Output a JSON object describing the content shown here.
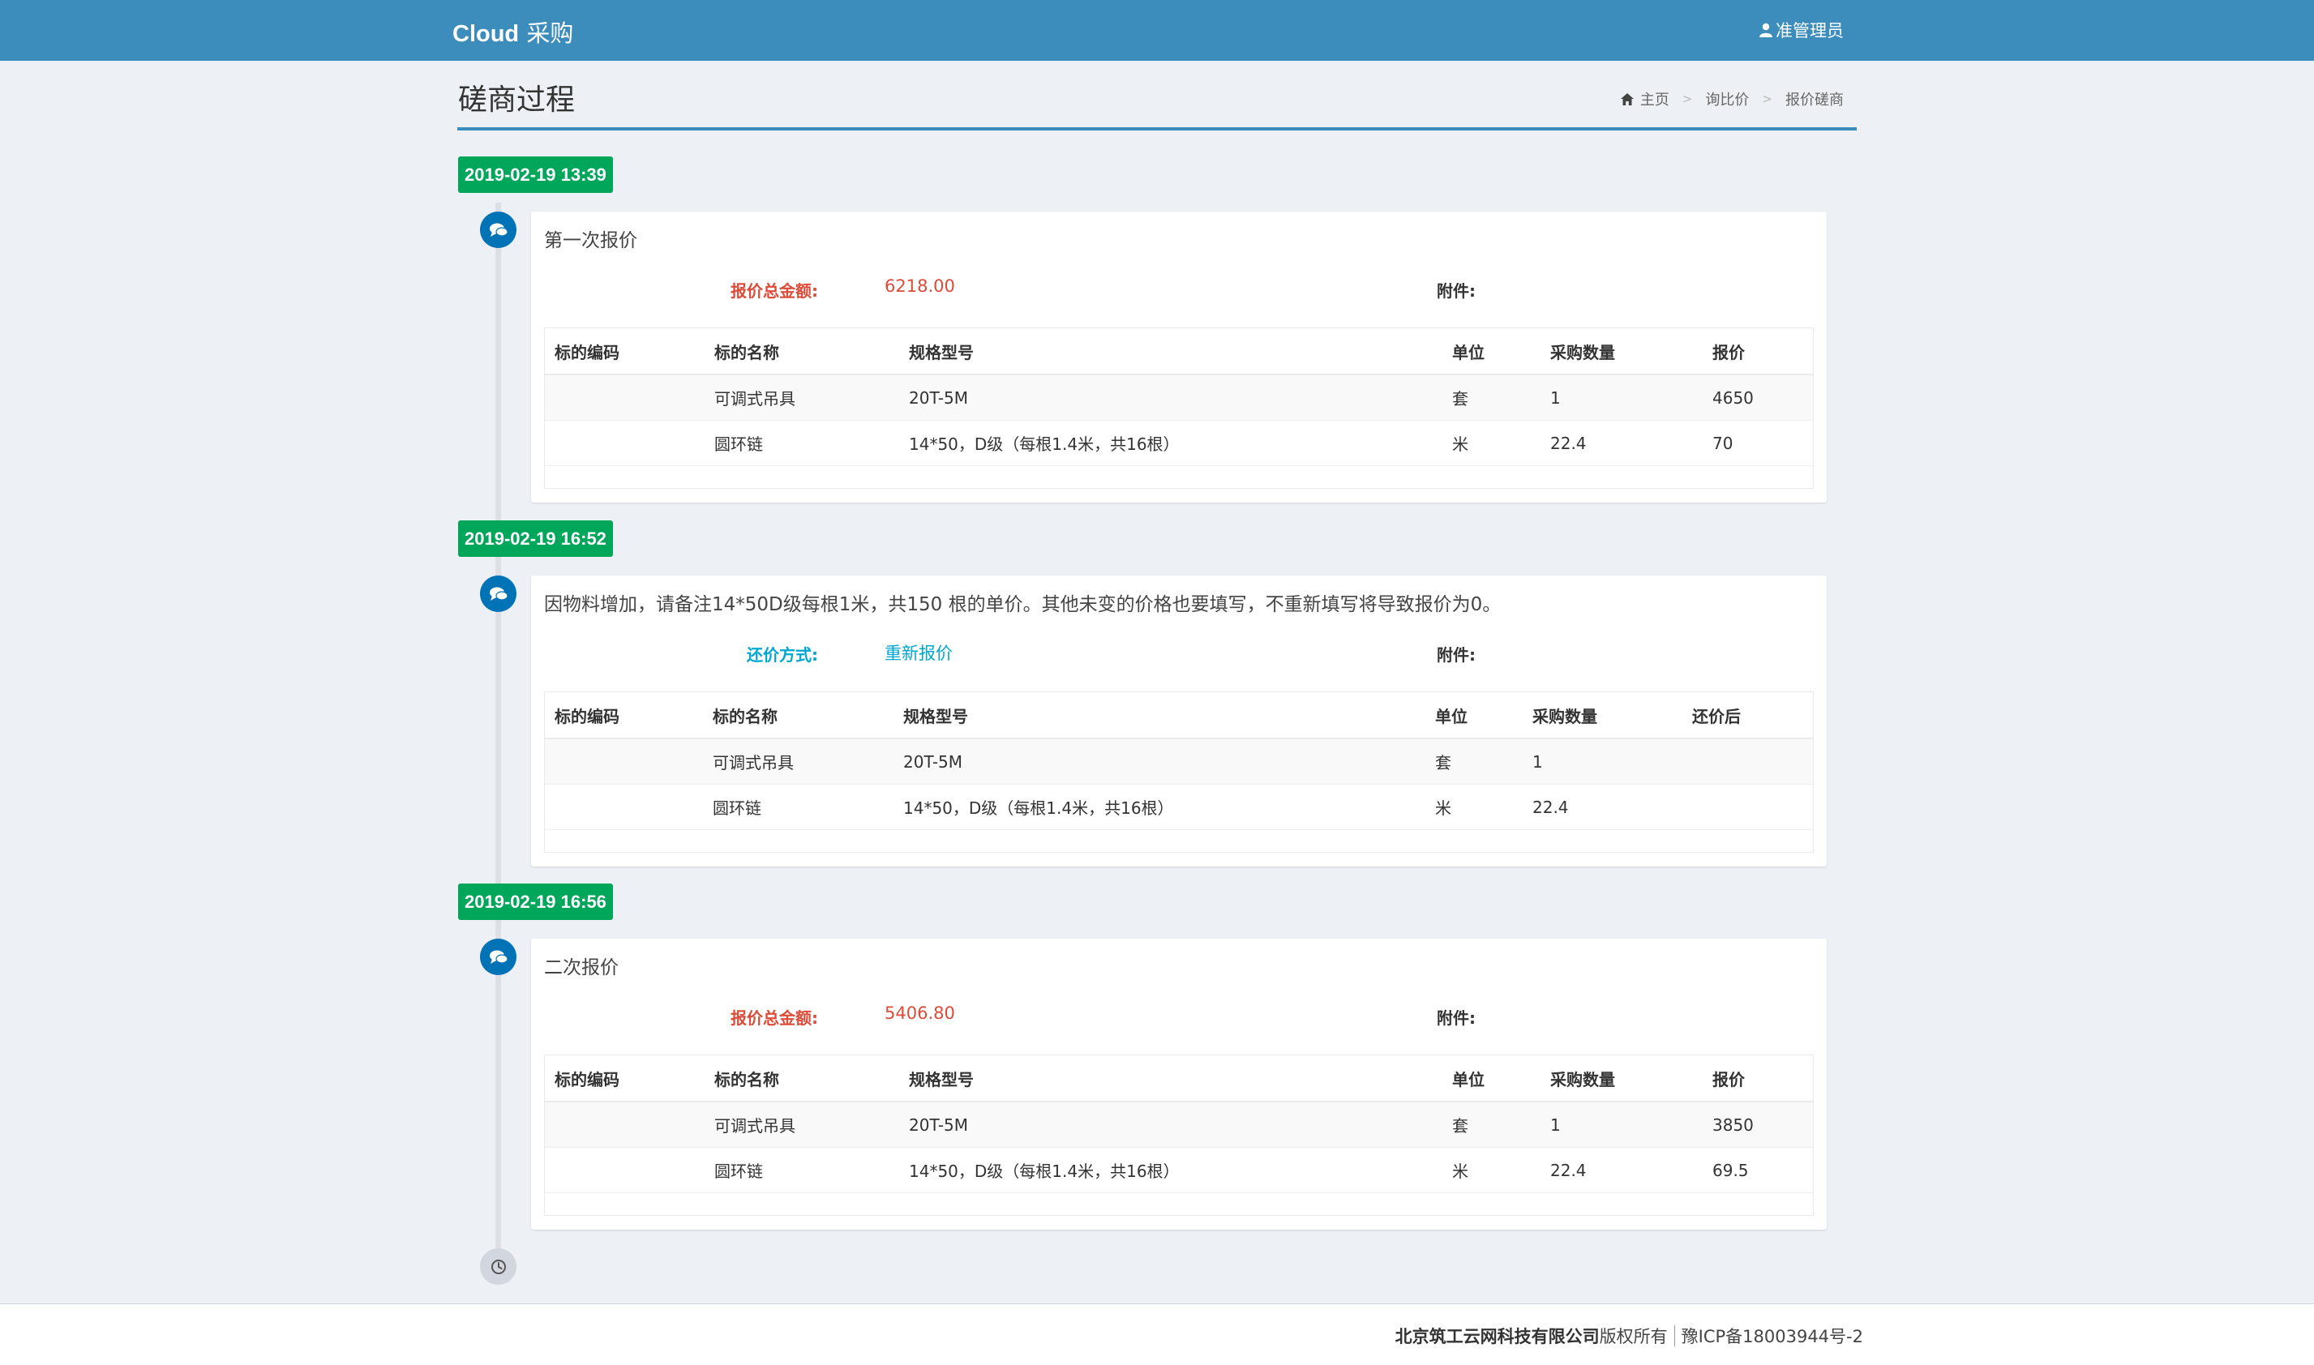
{
  "header": {
    "brand_bold": "Cloud",
    "brand_rest": " 采购",
    "user_label": "准管理员",
    "colors": {
      "bar": "#3c8dbc"
    }
  },
  "page": {
    "title": "磋商过程",
    "breadcrumb": [
      "主页",
      "询比价",
      "报价磋商"
    ]
  },
  "timeline": [
    {
      "time": "2019-02-19 13:39",
      "message": "第一次报价",
      "meta_label": "报价总金额:",
      "meta_value": "6218.00",
      "attachment_label": "附件:",
      "columns": [
        "标的编码",
        "标的名称",
        "规格型号",
        "单位",
        "采购数量",
        "报价"
      ],
      "rows": [
        [
          "",
          "可调式吊具",
          "20T-5M",
          "套",
          "1",
          "4650"
        ],
        [
          "",
          "圆环链",
          "14*50，D级（每根1.4米，共16根）",
          "米",
          "22.4",
          "70"
        ]
      ]
    },
    {
      "time": "2019-02-19 16:52",
      "message": "因物料增加，请备注14*50D级每根1米，共150 根的单价。其他未变的价格也要填写，不重新填写将导致报价为0。",
      "meta_label": "还价方式:",
      "meta_value": "重新报价",
      "attachment_label": "附件:",
      "columns": [
        "标的编码",
        "标的名称",
        "规格型号",
        "单位",
        "采购数量",
        "还价后"
      ],
      "rows": [
        [
          "",
          "可调式吊具",
          "20T-5M",
          "套",
          "1",
          ""
        ],
        [
          "",
          "圆环链",
          "14*50，D级（每根1.4米，共16根）",
          "米",
          "22.4",
          ""
        ]
      ]
    },
    {
      "time": "2019-02-19 16:56",
      "message": "二次报价",
      "meta_label": "报价总金额:",
      "meta_value": "5406.80",
      "attachment_label": "附件:",
      "columns": [
        "标的编码",
        "标的名称",
        "规格型号",
        "单位",
        "采购数量",
        "报价"
      ],
      "rows": [
        [
          "",
          "可调式吊具",
          "20T-5M",
          "套",
          "1",
          "3850"
        ],
        [
          "",
          "圆环链",
          "14*50，D级（每根1.4米，共16根）",
          "米",
          "22.4",
          "69.5"
        ]
      ]
    }
  ],
  "footer": {
    "company": "北京筑工云网科技有限公司",
    "rights": " 版权所有",
    "icp": "豫ICP备18003944号-2"
  }
}
